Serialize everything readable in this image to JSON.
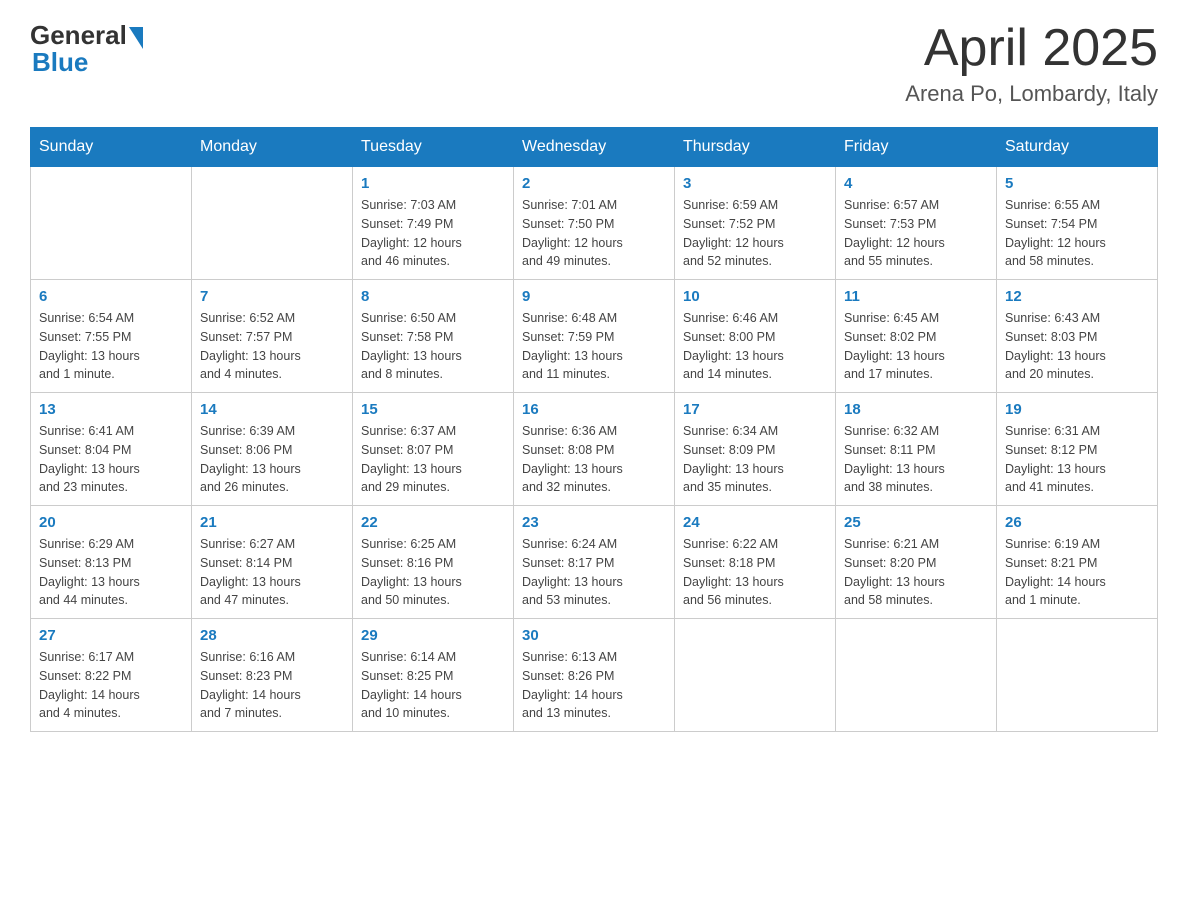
{
  "header": {
    "month_title": "April 2025",
    "location": "Arena Po, Lombardy, Italy",
    "logo_general": "General",
    "logo_blue": "Blue"
  },
  "columns": [
    "Sunday",
    "Monday",
    "Tuesday",
    "Wednesday",
    "Thursday",
    "Friday",
    "Saturday"
  ],
  "weeks": [
    [
      {
        "day": "",
        "info": ""
      },
      {
        "day": "",
        "info": ""
      },
      {
        "day": "1",
        "info": "Sunrise: 7:03 AM\nSunset: 7:49 PM\nDaylight: 12 hours\nand 46 minutes."
      },
      {
        "day": "2",
        "info": "Sunrise: 7:01 AM\nSunset: 7:50 PM\nDaylight: 12 hours\nand 49 minutes."
      },
      {
        "day": "3",
        "info": "Sunrise: 6:59 AM\nSunset: 7:52 PM\nDaylight: 12 hours\nand 52 minutes."
      },
      {
        "day": "4",
        "info": "Sunrise: 6:57 AM\nSunset: 7:53 PM\nDaylight: 12 hours\nand 55 minutes."
      },
      {
        "day": "5",
        "info": "Sunrise: 6:55 AM\nSunset: 7:54 PM\nDaylight: 12 hours\nand 58 minutes."
      }
    ],
    [
      {
        "day": "6",
        "info": "Sunrise: 6:54 AM\nSunset: 7:55 PM\nDaylight: 13 hours\nand 1 minute."
      },
      {
        "day": "7",
        "info": "Sunrise: 6:52 AM\nSunset: 7:57 PM\nDaylight: 13 hours\nand 4 minutes."
      },
      {
        "day": "8",
        "info": "Sunrise: 6:50 AM\nSunset: 7:58 PM\nDaylight: 13 hours\nand 8 minutes."
      },
      {
        "day": "9",
        "info": "Sunrise: 6:48 AM\nSunset: 7:59 PM\nDaylight: 13 hours\nand 11 minutes."
      },
      {
        "day": "10",
        "info": "Sunrise: 6:46 AM\nSunset: 8:00 PM\nDaylight: 13 hours\nand 14 minutes."
      },
      {
        "day": "11",
        "info": "Sunrise: 6:45 AM\nSunset: 8:02 PM\nDaylight: 13 hours\nand 17 minutes."
      },
      {
        "day": "12",
        "info": "Sunrise: 6:43 AM\nSunset: 8:03 PM\nDaylight: 13 hours\nand 20 minutes."
      }
    ],
    [
      {
        "day": "13",
        "info": "Sunrise: 6:41 AM\nSunset: 8:04 PM\nDaylight: 13 hours\nand 23 minutes."
      },
      {
        "day": "14",
        "info": "Sunrise: 6:39 AM\nSunset: 8:06 PM\nDaylight: 13 hours\nand 26 minutes."
      },
      {
        "day": "15",
        "info": "Sunrise: 6:37 AM\nSunset: 8:07 PM\nDaylight: 13 hours\nand 29 minutes."
      },
      {
        "day": "16",
        "info": "Sunrise: 6:36 AM\nSunset: 8:08 PM\nDaylight: 13 hours\nand 32 minutes."
      },
      {
        "day": "17",
        "info": "Sunrise: 6:34 AM\nSunset: 8:09 PM\nDaylight: 13 hours\nand 35 minutes."
      },
      {
        "day": "18",
        "info": "Sunrise: 6:32 AM\nSunset: 8:11 PM\nDaylight: 13 hours\nand 38 minutes."
      },
      {
        "day": "19",
        "info": "Sunrise: 6:31 AM\nSunset: 8:12 PM\nDaylight: 13 hours\nand 41 minutes."
      }
    ],
    [
      {
        "day": "20",
        "info": "Sunrise: 6:29 AM\nSunset: 8:13 PM\nDaylight: 13 hours\nand 44 minutes."
      },
      {
        "day": "21",
        "info": "Sunrise: 6:27 AM\nSunset: 8:14 PM\nDaylight: 13 hours\nand 47 minutes."
      },
      {
        "day": "22",
        "info": "Sunrise: 6:25 AM\nSunset: 8:16 PM\nDaylight: 13 hours\nand 50 minutes."
      },
      {
        "day": "23",
        "info": "Sunrise: 6:24 AM\nSunset: 8:17 PM\nDaylight: 13 hours\nand 53 minutes."
      },
      {
        "day": "24",
        "info": "Sunrise: 6:22 AM\nSunset: 8:18 PM\nDaylight: 13 hours\nand 56 minutes."
      },
      {
        "day": "25",
        "info": "Sunrise: 6:21 AM\nSunset: 8:20 PM\nDaylight: 13 hours\nand 58 minutes."
      },
      {
        "day": "26",
        "info": "Sunrise: 6:19 AM\nSunset: 8:21 PM\nDaylight: 14 hours\nand 1 minute."
      }
    ],
    [
      {
        "day": "27",
        "info": "Sunrise: 6:17 AM\nSunset: 8:22 PM\nDaylight: 14 hours\nand 4 minutes."
      },
      {
        "day": "28",
        "info": "Sunrise: 6:16 AM\nSunset: 8:23 PM\nDaylight: 14 hours\nand 7 minutes."
      },
      {
        "day": "29",
        "info": "Sunrise: 6:14 AM\nSunset: 8:25 PM\nDaylight: 14 hours\nand 10 minutes."
      },
      {
        "day": "30",
        "info": "Sunrise: 6:13 AM\nSunset: 8:26 PM\nDaylight: 14 hours\nand 13 minutes."
      },
      {
        "day": "",
        "info": ""
      },
      {
        "day": "",
        "info": ""
      },
      {
        "day": "",
        "info": ""
      }
    ]
  ]
}
